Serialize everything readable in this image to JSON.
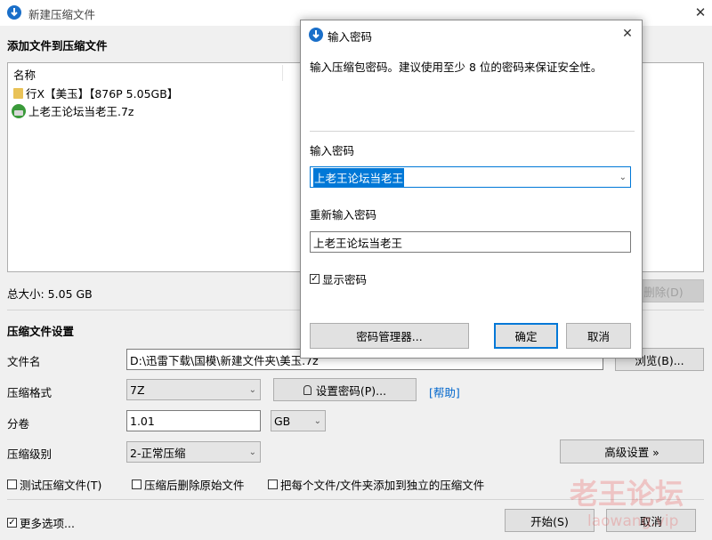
{
  "window": {
    "title": "新建压缩文件",
    "close_glyph": "✕"
  },
  "files_section": {
    "header": "添加文件到压缩文件",
    "column_name": "名称",
    "items": [
      {
        "name": "行X【美玉】【876P 5.05GB】",
        "icon": "folder-icon"
      },
      {
        "name": "上老王论坛当老王.7z",
        "icon": "archive-icon"
      }
    ],
    "total_size": "总大小: 5.05 GB",
    "delete_button": "删除(D)"
  },
  "settings": {
    "header": "压缩文件设置",
    "filename_label": "文件名",
    "filename_value": "D:\\迅雷下载\\国模\\新建文件夹\\美玉.7z",
    "browse_button": "浏览(B)...",
    "format_label": "压缩格式",
    "format_value": "7Z",
    "set_password_button": "设置密码(P)...",
    "help_link": "[帮助]",
    "volume_label": "分卷",
    "volume_value": "1.01",
    "volume_unit": "GB",
    "level_label": "压缩级别",
    "level_value": "2-正常压缩",
    "advanced_button": "高级设置 »",
    "test_archive": "测试压缩文件(T)",
    "delete_after": "压缩后删除原始文件",
    "separate_archives": "把每个文件/文件夹添加到独立的压缩文件",
    "more_options": "更多选项...",
    "start_button": "开始(S)",
    "cancel_button": "取消"
  },
  "watermark": {
    "brand": "老王论坛",
    "url": "laowang.vip"
  },
  "dialog": {
    "title": "输入密码",
    "description": "输入压缩包密码。建议使用至少 8 位的密码来保证安全性。",
    "password_label": "输入密码",
    "password_value": "上老王论坛当老王",
    "reenter_label": "重新输入密码",
    "reenter_value": "上老王论坛当老王",
    "show_password": "显示密码",
    "password_manager_button": "密码管理器...",
    "ok_button": "确定",
    "cancel_button": "取消"
  },
  "colors": {
    "accent": "#0078d7",
    "app_icon": "#1a6fc9",
    "link": "#0066cc",
    "watermark": "#e85252"
  }
}
